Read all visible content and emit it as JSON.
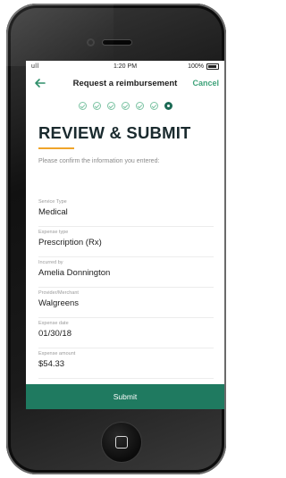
{
  "status_bar": {
    "signal": "ull",
    "time": "1:20 PM",
    "battery": "100%"
  },
  "nav": {
    "title": "Request a reimbursement",
    "cancel": "Cancel",
    "back_icon": "arrow-left-icon"
  },
  "stepper": {
    "total_steps": 7,
    "current_step": 7
  },
  "page": {
    "title": "REVIEW & SUBMIT",
    "instructions": "Please confirm the information you entered:"
  },
  "fields": [
    {
      "label": "Service Type",
      "value": "Medical"
    },
    {
      "label": "Expense type",
      "value": "Prescription (Rx)"
    },
    {
      "label": "Incurred by",
      "value": "Amelia Donnington"
    },
    {
      "label": "Provider/Merchant",
      "value": "Walgreens"
    },
    {
      "label": "Expense date",
      "value": "01/30/18"
    },
    {
      "label": "Expense amount",
      "value": "$54.33"
    }
  ],
  "submit": {
    "label": "Submit"
  },
  "colors": {
    "brand_green": "#1f7a60",
    "accent_orange": "#f0a42a",
    "cancel_green": "#3fa37a"
  }
}
